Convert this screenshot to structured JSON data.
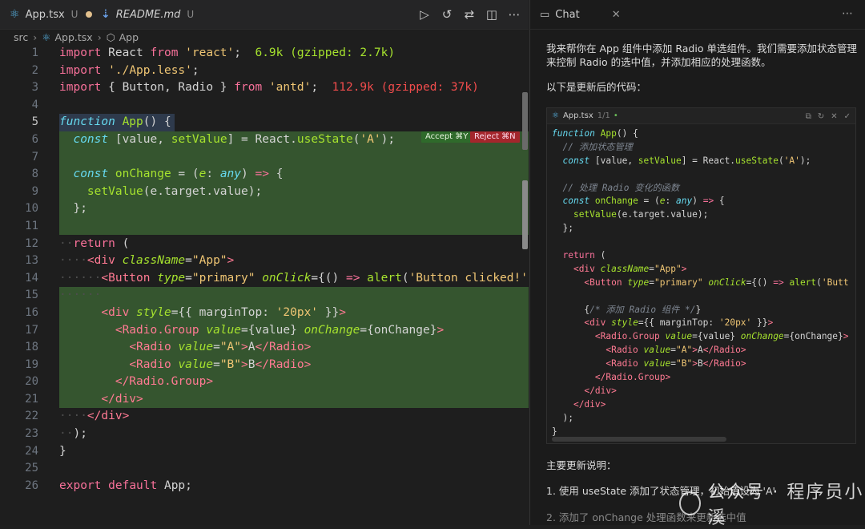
{
  "editor": {
    "tabs": [
      {
        "label": "App.tsx",
        "status": "U",
        "icon": "react-icon",
        "dirty": true
      },
      {
        "label": "README.md",
        "status": "U",
        "icon": "markdown-icon",
        "dirty": false
      }
    ],
    "toolbar_icons": [
      "run-icon",
      "history-icon",
      "compare-icon",
      "split-editor-icon",
      "more-icon"
    ],
    "breadcrumb": [
      "src",
      "App.tsx",
      "App"
    ],
    "line_numbers": [
      "1",
      "2",
      "3",
      "4",
      "5",
      "6",
      "7",
      "8",
      "9",
      "10",
      "11",
      "12",
      "13",
      "14",
      "15",
      "16",
      "17",
      "18",
      "19",
      "20",
      "21",
      "22",
      "23",
      "24",
      "25",
      "26"
    ],
    "current_line": "5",
    "accept_label": "Accept ⌘Y",
    "reject_label": "Reject ⌘N",
    "import_hints": {
      "react": "6.9k (gzipped: 2.7k)",
      "antd": "112.9k (gzipped: 37k)"
    }
  },
  "chat": {
    "tab_label": "Chat",
    "intro": "我来帮你在 App 组件中添加 Radio 单选组件。我们需要添加状态管理来控制 Radio 的选中值，并添加相应的处理函数。",
    "code_intro": "以下是更新后的代码：",
    "card_file": "App.tsx",
    "card_page": "1/1",
    "summary_title": "主要更新说明：",
    "summary_item1": "1. 使用 useState 添加了状态管理，初始值设为 'A'",
    "summary_item2": "2. 添加了 onChange 处理函数来更新选中值"
  },
  "watermark": "公众号 · 程序员小溪",
  "colors": {
    "accept": "#2f6a2b",
    "reject": "#a4262c",
    "diff_add": "#35552f"
  }
}
